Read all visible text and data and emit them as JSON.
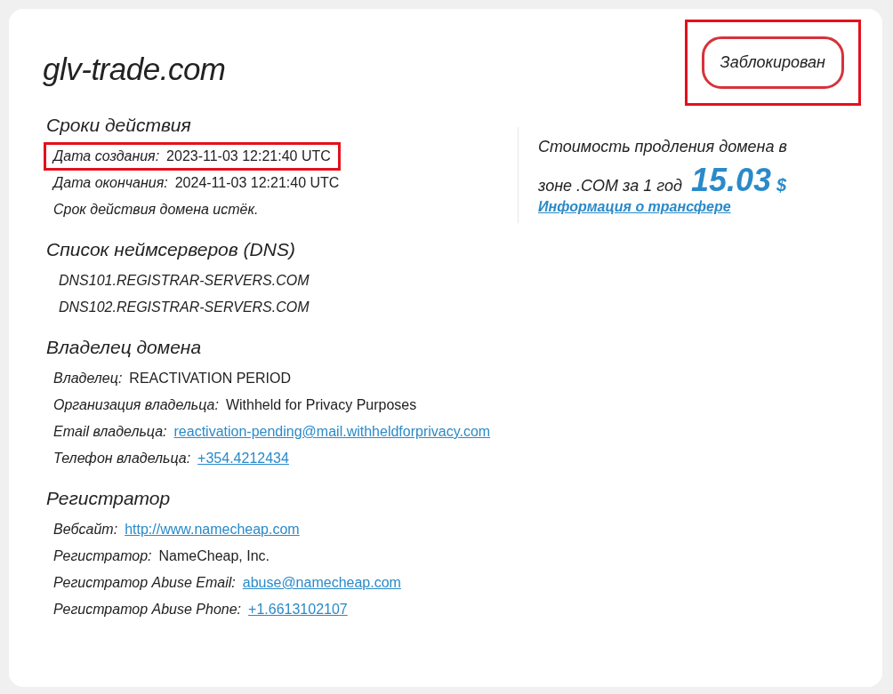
{
  "domain": "glv-trade.com",
  "status": {
    "label": "Заблокирован",
    "highlighted": true
  },
  "sections": [
    {
      "heading": "Сроки действия",
      "kind": "fields",
      "rows": [
        {
          "kind": "text",
          "label": "Дата создания:",
          "value": "2023-11-03 12:21:40 UTC",
          "highlighted": true
        },
        {
          "kind": "text",
          "label": "Дата окончания:",
          "value": "2024-11-03 12:21:40 UTC",
          "highlighted": false
        },
        {
          "kind": "note",
          "label": "Срок действия домена истёк.",
          "highlighted": false
        }
      ]
    },
    {
      "heading": "Список неймсерверов (DNS)",
      "kind": "list",
      "items": [
        "DNS101.REGISTRAR-SERVERS.COM",
        "DNS102.REGISTRAR-SERVERS.COM"
      ]
    },
    {
      "heading": "Владелец домена",
      "kind": "fields",
      "rows": [
        {
          "kind": "text",
          "label": "Владелец:",
          "value": "REACTIVATION PERIOD",
          "highlighted": false
        },
        {
          "kind": "text",
          "label": "Организация владельца:",
          "value": "Withheld for Privacy Purposes",
          "highlighted": false
        },
        {
          "kind": "link",
          "label": "Email владельца:",
          "value": "reactivation-pending@mail.withheldforprivacy.com",
          "highlighted": false
        },
        {
          "kind": "link",
          "label": "Телефон владельца:",
          "value": "+354.4212434",
          "highlighted": false
        }
      ]
    },
    {
      "heading": "Регистратор",
      "kind": "fields",
      "rows": [
        {
          "kind": "link",
          "label": "Вебсайт:",
          "value": "http://www.namecheap.com",
          "highlighted": false
        },
        {
          "kind": "text",
          "label": "Регистратор:",
          "value": "NameCheap, Inc.",
          "highlighted": false
        },
        {
          "kind": "link",
          "label": "Регистратор Abuse Email:",
          "value": "abuse@namecheap.com",
          "highlighted": false
        },
        {
          "kind": "link",
          "label": "Регистратор Abuse Phone:",
          "value": "+1.6613102107",
          "highlighted": false
        }
      ]
    }
  ],
  "renewal": {
    "text_1": "Стоимость продления домена в",
    "text_2": "зоне .COM за 1 год",
    "price": "15.03",
    "currency": "$",
    "link": "Информация о трансфере"
  }
}
